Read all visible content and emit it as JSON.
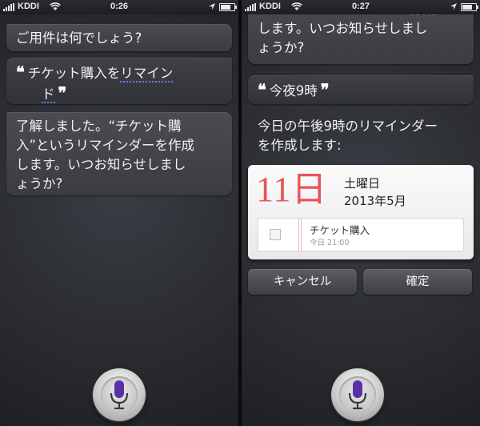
{
  "left": {
    "status": {
      "carrier": "KDDI",
      "time": "0:26"
    },
    "siri_prompt": "ご用件は何でしょう?",
    "user_quote": {
      "open": "❝",
      "line1": "チケット購入を",
      "line1_underlined": "リマイン",
      "line2_underlined": "ド",
      "close": "❞"
    },
    "siri_reply_lines": [
      "了解しました。“チケット購",
      "入”というリマインダーを作成",
      "します。いつお知らせしまし",
      "ょうか?"
    ]
  },
  "right": {
    "status": {
      "carrier": "KDDI",
      "time": "0:27"
    },
    "prev_reply_lines": [
      "入”というリマインダーを作成",
      "します。いつお知らせしまし",
      "ょうか?"
    ],
    "user_quote": {
      "open": "❝",
      "text": "今夜9時",
      "close": "❞"
    },
    "siri_reply_lines": [
      "今日の午後9時のリマインダー",
      "を作成します:"
    ],
    "card": {
      "day": "11日",
      "weekday": "土曜日",
      "year_month": "2013年5月",
      "reminder_title": "チケット購入",
      "reminder_time": "今日 21:00"
    },
    "buttons": {
      "cancel": "キャンセル",
      "confirm": "確定"
    }
  },
  "colors": {
    "accent_date": "#e8545a",
    "underline": "#6a7cff",
    "mic_purple": "#5a2fa8"
  }
}
